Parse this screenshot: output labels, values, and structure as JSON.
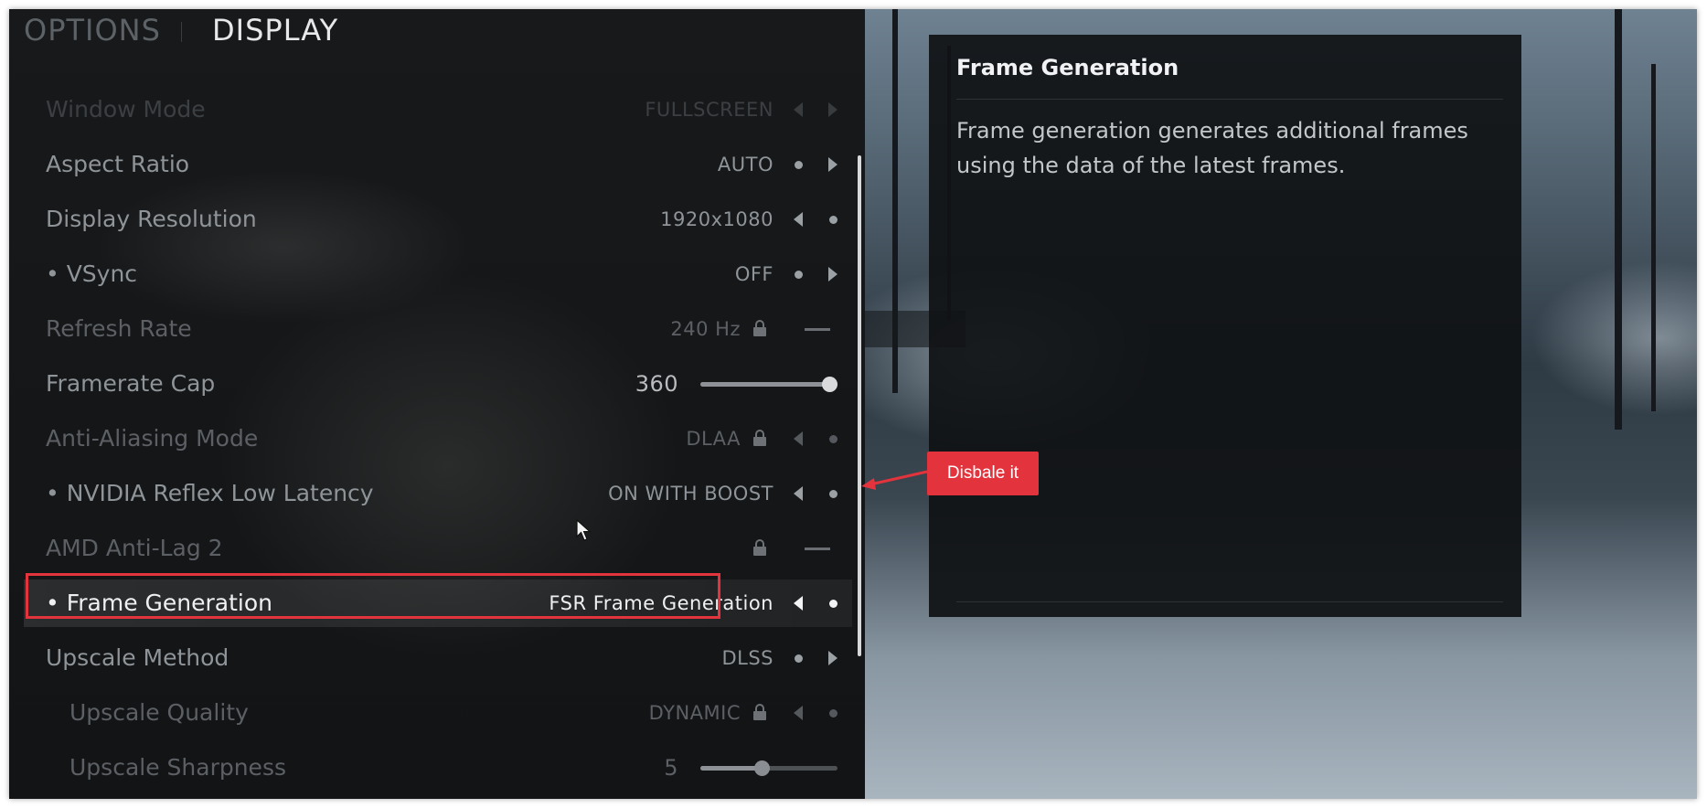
{
  "header": {
    "tabs": [
      {
        "label": "OPTIONS",
        "active": false
      },
      {
        "label": "DISPLAY",
        "active": true
      }
    ]
  },
  "settings": [
    {
      "label": "Window Mode",
      "value": "FULLSCREEN",
      "state": "faded"
    },
    {
      "label": "Aspect Ratio",
      "value": "AUTO"
    },
    {
      "label": "Display Resolution",
      "value": "1920x1080"
    },
    {
      "label": "• VSync",
      "value": "OFF"
    },
    {
      "label": "Refresh Rate",
      "value": "240 Hz",
      "state": "locked"
    },
    {
      "label": "Framerate Cap",
      "value": "360",
      "slider_fraction": 1.0
    },
    {
      "label": "Anti-Aliasing Mode",
      "value": "DLAA",
      "state": "locked"
    },
    {
      "label": "• NVIDIA Reflex Low Latency",
      "value": "ON WITH BOOST"
    },
    {
      "label": "AMD Anti-Lag 2",
      "value": "",
      "state": "locked"
    },
    {
      "label": "• Frame Generation",
      "value": "FSR Frame Generation",
      "state": "selected"
    },
    {
      "label": "Upscale Method",
      "value": "DLSS"
    },
    {
      "label": "Upscale Quality",
      "value": "DYNAMIC",
      "state": "locked"
    },
    {
      "label": "Upscale Sharpness",
      "value": "5",
      "slider_fraction": 0.45
    }
  ],
  "info_panel": {
    "title": "Frame Generation",
    "description": "Frame generation generates additional frames using the data of the latest frames."
  },
  "annotation": {
    "text": "Disbale it",
    "color": "#e3333c"
  },
  "icons": [
    "lock-icon",
    "arrow-left-icon",
    "arrow-right-icon",
    "dot-icon",
    "cursor-icon"
  ]
}
